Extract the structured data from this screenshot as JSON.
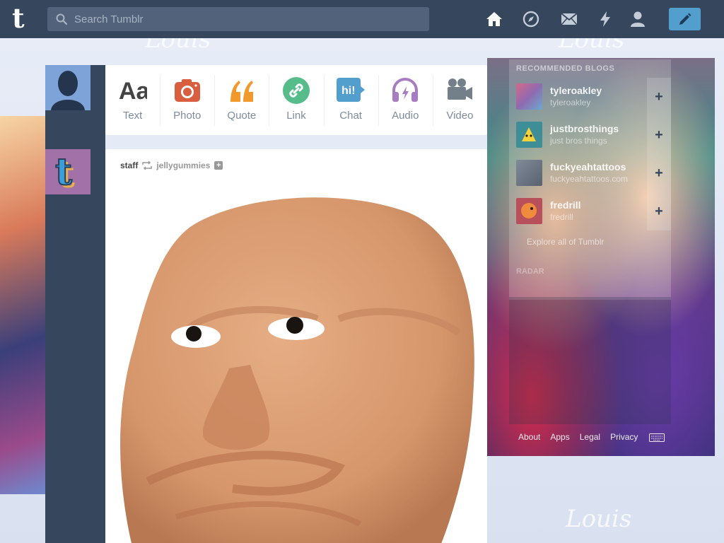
{
  "header": {
    "logo": "t",
    "search_placeholder": "Search Tumblr",
    "nav": [
      {
        "name": "dashboard",
        "icon": "home-icon"
      },
      {
        "name": "explore",
        "icon": "compass-icon"
      },
      {
        "name": "inbox",
        "icon": "envelope-icon"
      },
      {
        "name": "activity",
        "icon": "lightning-icon"
      },
      {
        "name": "account",
        "icon": "person-icon"
      }
    ],
    "compose_icon": "pencil-icon"
  },
  "post_types": [
    {
      "label": "Text",
      "icon": "text-icon",
      "color": "#444444"
    },
    {
      "label": "Photo",
      "icon": "camera-icon",
      "color": "#d95e40"
    },
    {
      "label": "Quote",
      "icon": "quote-icon",
      "color": "#f2992e"
    },
    {
      "label": "Link",
      "icon": "link-icon",
      "color": "#56bc8a"
    },
    {
      "label": "Chat",
      "icon": "chat-icon",
      "color": "#529ecc"
    },
    {
      "label": "Audio",
      "icon": "headphones-icon",
      "color": "#a77dc2"
    },
    {
      "label": "Video",
      "icon": "video-camera-icon",
      "color": "#748089"
    }
  ],
  "post": {
    "author": "staff",
    "reblogged_from": "jellygummies",
    "follow_symbol": "+"
  },
  "sidebar": {
    "title": "RECOMMENDED BLOGS",
    "blogs": [
      {
        "name": "tyleroakley",
        "sub": "tyleroakley"
      },
      {
        "name": "justbrosthings",
        "sub": "just bros things"
      },
      {
        "name": "fuckyeahtattoos",
        "sub": "fuckyeahtattoos.com"
      },
      {
        "name": "fredrill",
        "sub": "fredrill"
      }
    ],
    "explore": "Explore all of Tumblr",
    "radar_title": "RADAR",
    "plus_symbol": "+"
  },
  "footer": {
    "links": [
      "About",
      "Apps",
      "Legal",
      "Privacy"
    ]
  },
  "colors": {
    "header_bg": "#36465d",
    "compose": "#529ecc"
  }
}
